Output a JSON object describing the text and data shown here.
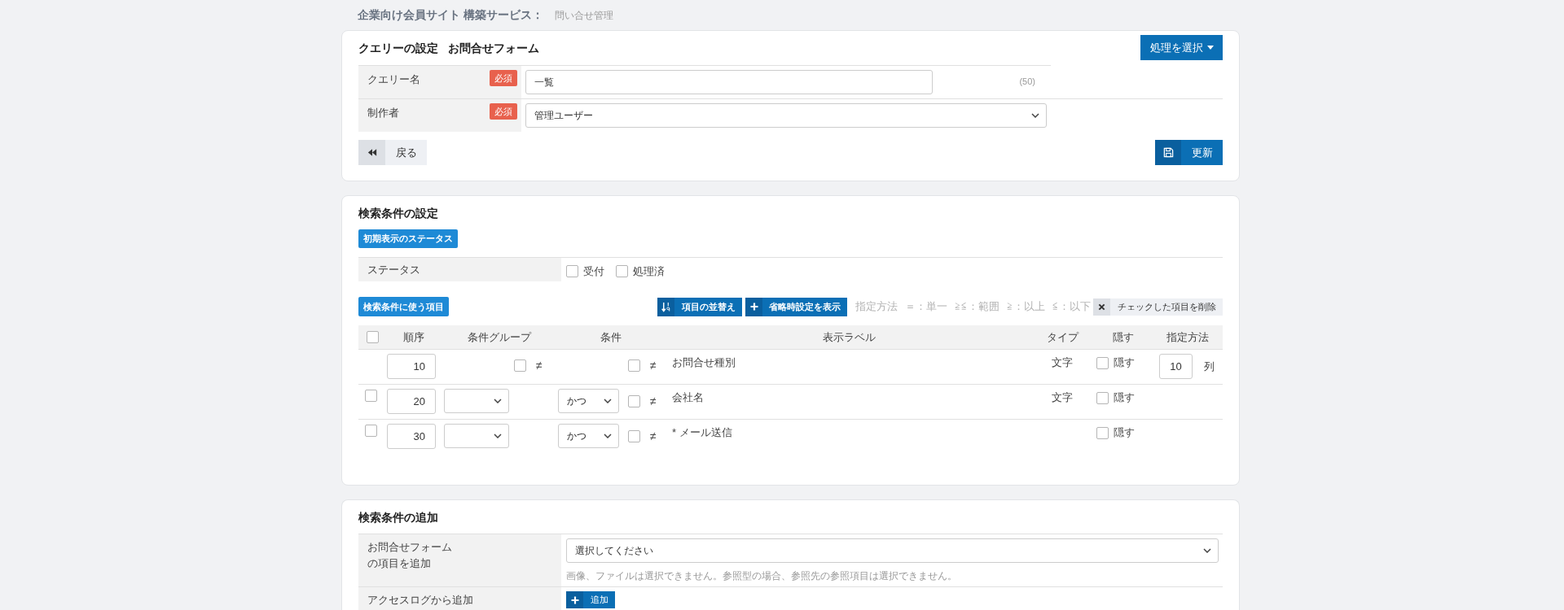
{
  "breadcrumb": {
    "title": "企業向け会員サイト 構築サービス：",
    "page": "問い合せ管理"
  },
  "query_settings": {
    "title": "クエリーの設定",
    "form_name": "お問合せフォーム",
    "action_button": "処理を選択",
    "fields": [
      {
        "kind": "text",
        "label": "クエリー名",
        "badge": "必須",
        "value": "一覧",
        "counter": "(50)"
      },
      {
        "kind": "select",
        "label": "制作者",
        "badge": "必須",
        "value": "管理ユーザー"
      }
    ],
    "back_button": "戻る",
    "update_button": "更新"
  },
  "search_settings": {
    "title": "検索条件の設定",
    "status_button": "初期表示のステータス",
    "status": {
      "label": "ステータス",
      "options": [
        {
          "label": "受付",
          "checked": false
        },
        {
          "label": "処理済",
          "checked": false
        }
      ]
    },
    "items_button": "検索条件に使う項目",
    "sort_button": "項目の並替え",
    "defaults_button": "省略時設定を表示",
    "legend": [
      "指定方法",
      "＝：単一",
      "≧≦：範囲",
      "≧：以上",
      "≦：以下"
    ],
    "delete_button": "チェックした項目を削除",
    "table": {
      "all_checked": false,
      "columns": [
        "順序",
        "条件グループ",
        "条件",
        "表示ラベル",
        "タイプ",
        "隠す",
        "指定方法"
      ],
      "rows": [
        {
          "kind": "fixed",
          "order": "10",
          "group_negate": {
            "checked": false,
            "label": "≠"
          },
          "condition_negate": {
            "checked": false,
            "label": "≠"
          },
          "label": "お問合せ種別",
          "type": "文字",
          "hide": {
            "checked": false,
            "label": "隠す"
          },
          "method": {
            "value": "10",
            "unit": "列"
          }
        },
        {
          "kind": "editable",
          "checked": false,
          "order": "20",
          "condition": "かつ",
          "condition_negate": {
            "checked": false,
            "label": "≠"
          },
          "label": "会社名",
          "type": "文字",
          "hide": {
            "checked": false,
            "label": "隠す"
          }
        },
        {
          "kind": "editable",
          "checked": false,
          "order": "30",
          "condition": "かつ",
          "condition_negate": {
            "checked": false,
            "label": "≠"
          },
          "label": "* メール送信",
          "hide": {
            "checked": false,
            "label": "隠す"
          }
        }
      ]
    }
  },
  "add_condition": {
    "title": "検索条件の追加",
    "rows": [
      {
        "kind": "select",
        "label": "お問合せフォームの項目を追加",
        "value": "選択してください",
        "note": "画像、ファイルは選択できません。参照型の場合、参照先の参照項目は選択できません。"
      },
      {
        "kind": "button",
        "label": "アクセスログから追加",
        "button": "追加"
      }
    ]
  }
}
